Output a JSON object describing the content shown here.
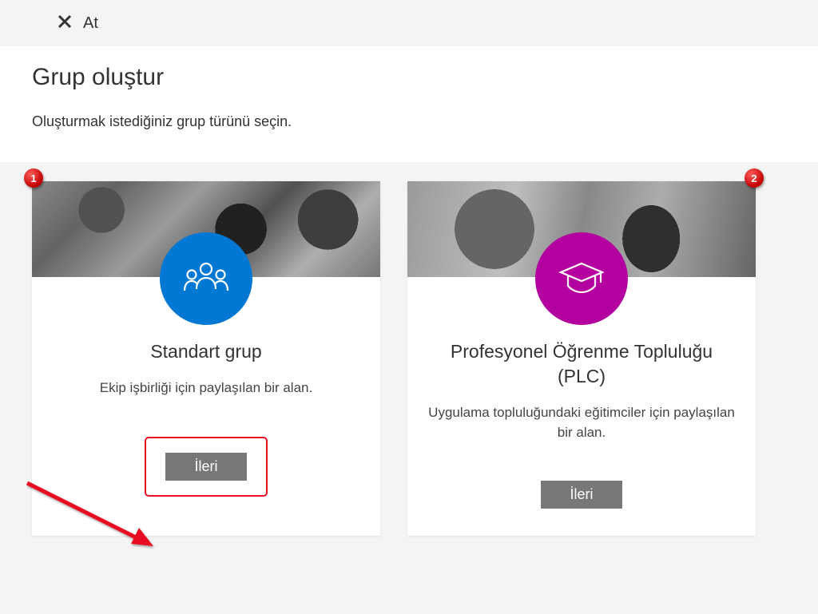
{
  "topbar": {
    "discard_label": "At"
  },
  "header": {
    "title": "Grup oluştur",
    "subtitle": "Oluşturmak istediğiniz grup türünü seçin."
  },
  "cards": [
    {
      "badge": "1",
      "icon": "people-icon",
      "icon_color": "#0078d4",
      "title": "Standart grup",
      "description": "Ekip işbirliği için paylaşılan bir alan.",
      "button_label": "İleri",
      "highlighted": true
    },
    {
      "badge": "2",
      "icon": "graduation-cap-icon",
      "icon_color": "#b4009e",
      "title": "Profesyonel Öğrenme Topluluğu (PLC)",
      "description": "Uygulama topluluğundaki eğitimciler için paylaşılan bir alan.",
      "button_label": "İleri",
      "highlighted": false
    }
  ],
  "annotation": {
    "arrow_color": "#e81123"
  }
}
